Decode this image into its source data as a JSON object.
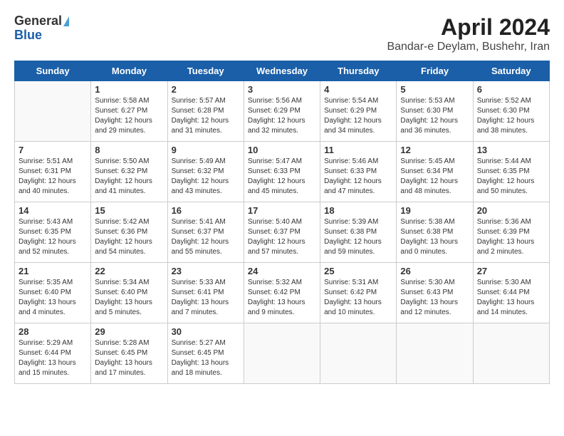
{
  "header": {
    "logo_line1": "General",
    "logo_line2": "Blue",
    "title": "April 2024",
    "subtitle": "Bandar-e Deylam, Bushehr, Iran"
  },
  "weekdays": [
    "Sunday",
    "Monday",
    "Tuesday",
    "Wednesday",
    "Thursday",
    "Friday",
    "Saturday"
  ],
  "weeks": [
    [
      {
        "day": "",
        "info": ""
      },
      {
        "day": "1",
        "info": "Sunrise: 5:58 AM\nSunset: 6:27 PM\nDaylight: 12 hours\nand 29 minutes."
      },
      {
        "day": "2",
        "info": "Sunrise: 5:57 AM\nSunset: 6:28 PM\nDaylight: 12 hours\nand 31 minutes."
      },
      {
        "day": "3",
        "info": "Sunrise: 5:56 AM\nSunset: 6:29 PM\nDaylight: 12 hours\nand 32 minutes."
      },
      {
        "day": "4",
        "info": "Sunrise: 5:54 AM\nSunset: 6:29 PM\nDaylight: 12 hours\nand 34 minutes."
      },
      {
        "day": "5",
        "info": "Sunrise: 5:53 AM\nSunset: 6:30 PM\nDaylight: 12 hours\nand 36 minutes."
      },
      {
        "day": "6",
        "info": "Sunrise: 5:52 AM\nSunset: 6:30 PM\nDaylight: 12 hours\nand 38 minutes."
      }
    ],
    [
      {
        "day": "7",
        "info": "Sunrise: 5:51 AM\nSunset: 6:31 PM\nDaylight: 12 hours\nand 40 minutes."
      },
      {
        "day": "8",
        "info": "Sunrise: 5:50 AM\nSunset: 6:32 PM\nDaylight: 12 hours\nand 41 minutes."
      },
      {
        "day": "9",
        "info": "Sunrise: 5:49 AM\nSunset: 6:32 PM\nDaylight: 12 hours\nand 43 minutes."
      },
      {
        "day": "10",
        "info": "Sunrise: 5:47 AM\nSunset: 6:33 PM\nDaylight: 12 hours\nand 45 minutes."
      },
      {
        "day": "11",
        "info": "Sunrise: 5:46 AM\nSunset: 6:33 PM\nDaylight: 12 hours\nand 47 minutes."
      },
      {
        "day": "12",
        "info": "Sunrise: 5:45 AM\nSunset: 6:34 PM\nDaylight: 12 hours\nand 48 minutes."
      },
      {
        "day": "13",
        "info": "Sunrise: 5:44 AM\nSunset: 6:35 PM\nDaylight: 12 hours\nand 50 minutes."
      }
    ],
    [
      {
        "day": "14",
        "info": "Sunrise: 5:43 AM\nSunset: 6:35 PM\nDaylight: 12 hours\nand 52 minutes."
      },
      {
        "day": "15",
        "info": "Sunrise: 5:42 AM\nSunset: 6:36 PM\nDaylight: 12 hours\nand 54 minutes."
      },
      {
        "day": "16",
        "info": "Sunrise: 5:41 AM\nSunset: 6:37 PM\nDaylight: 12 hours\nand 55 minutes."
      },
      {
        "day": "17",
        "info": "Sunrise: 5:40 AM\nSunset: 6:37 PM\nDaylight: 12 hours\nand 57 minutes."
      },
      {
        "day": "18",
        "info": "Sunrise: 5:39 AM\nSunset: 6:38 PM\nDaylight: 12 hours\nand 59 minutes."
      },
      {
        "day": "19",
        "info": "Sunrise: 5:38 AM\nSunset: 6:38 PM\nDaylight: 13 hours\nand 0 minutes."
      },
      {
        "day": "20",
        "info": "Sunrise: 5:36 AM\nSunset: 6:39 PM\nDaylight: 13 hours\nand 2 minutes."
      }
    ],
    [
      {
        "day": "21",
        "info": "Sunrise: 5:35 AM\nSunset: 6:40 PM\nDaylight: 13 hours\nand 4 minutes."
      },
      {
        "day": "22",
        "info": "Sunrise: 5:34 AM\nSunset: 6:40 PM\nDaylight: 13 hours\nand 5 minutes."
      },
      {
        "day": "23",
        "info": "Sunrise: 5:33 AM\nSunset: 6:41 PM\nDaylight: 13 hours\nand 7 minutes."
      },
      {
        "day": "24",
        "info": "Sunrise: 5:32 AM\nSunset: 6:42 PM\nDaylight: 13 hours\nand 9 minutes."
      },
      {
        "day": "25",
        "info": "Sunrise: 5:31 AM\nSunset: 6:42 PM\nDaylight: 13 hours\nand 10 minutes."
      },
      {
        "day": "26",
        "info": "Sunrise: 5:30 AM\nSunset: 6:43 PM\nDaylight: 13 hours\nand 12 minutes."
      },
      {
        "day": "27",
        "info": "Sunrise: 5:30 AM\nSunset: 6:44 PM\nDaylight: 13 hours\nand 14 minutes."
      }
    ],
    [
      {
        "day": "28",
        "info": "Sunrise: 5:29 AM\nSunset: 6:44 PM\nDaylight: 13 hours\nand 15 minutes."
      },
      {
        "day": "29",
        "info": "Sunrise: 5:28 AM\nSunset: 6:45 PM\nDaylight: 13 hours\nand 17 minutes."
      },
      {
        "day": "30",
        "info": "Sunrise: 5:27 AM\nSunset: 6:45 PM\nDaylight: 13 hours\nand 18 minutes."
      },
      {
        "day": "",
        "info": ""
      },
      {
        "day": "",
        "info": ""
      },
      {
        "day": "",
        "info": ""
      },
      {
        "day": "",
        "info": ""
      }
    ]
  ]
}
